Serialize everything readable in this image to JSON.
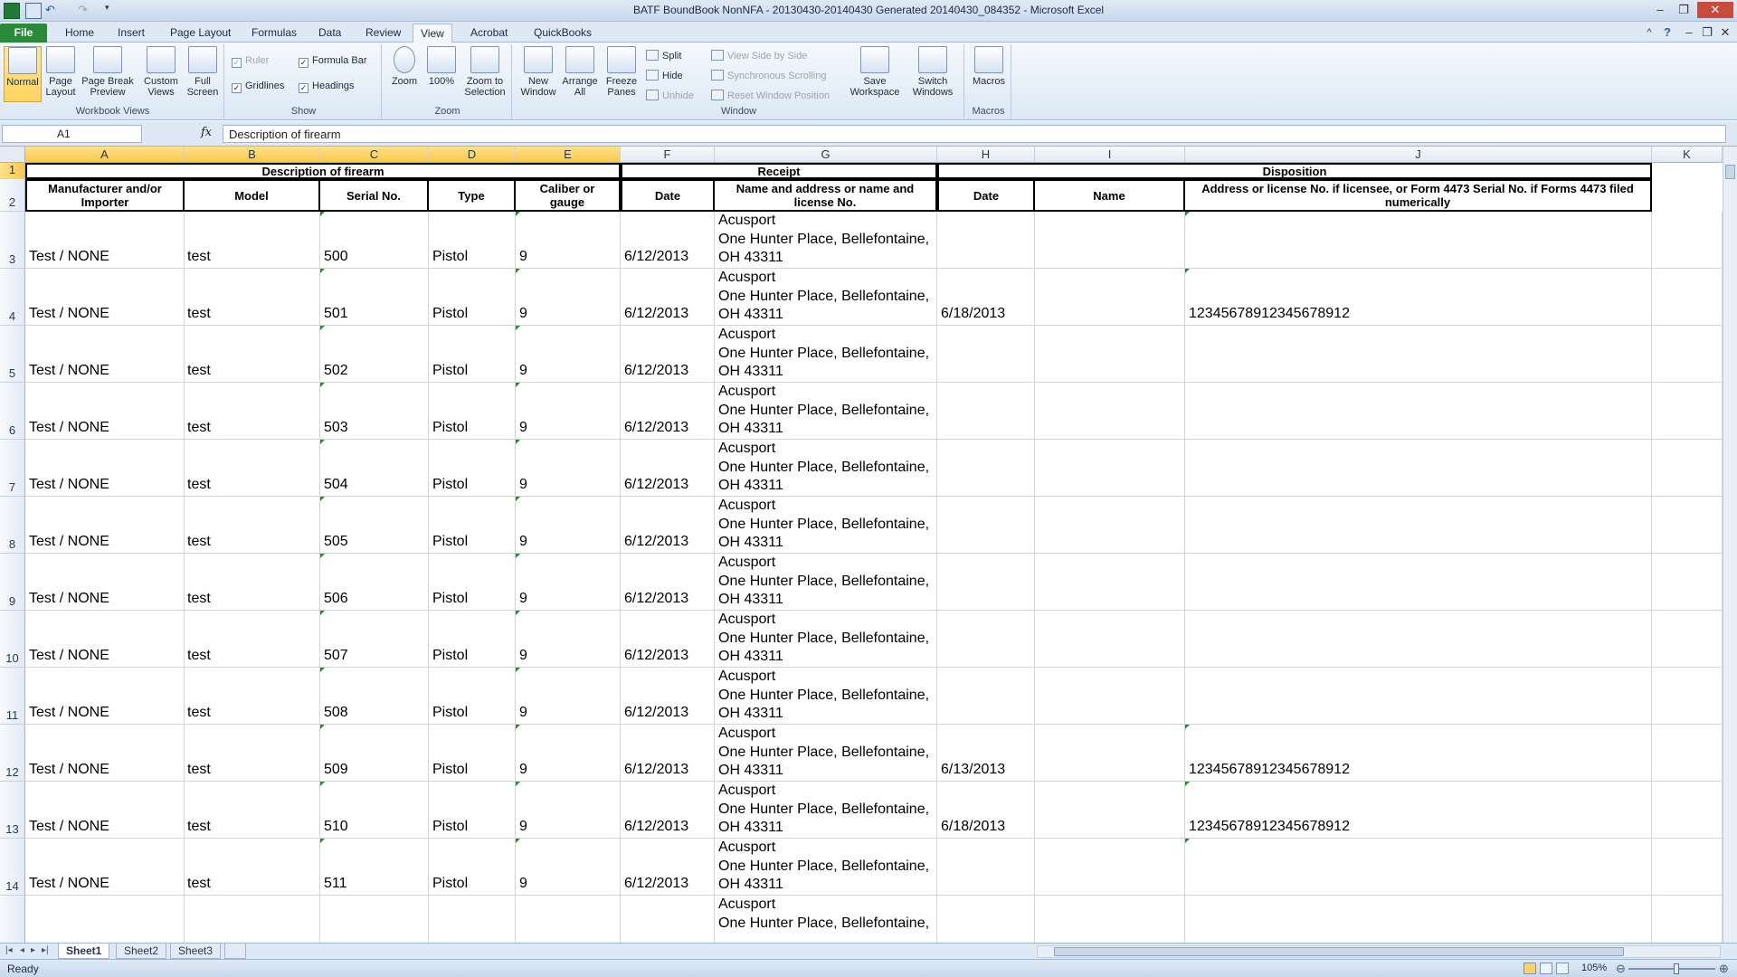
{
  "window": {
    "title": "BATF BoundBook NonNFA - 20130430-20140430 Generated 20140430_084352  -  Microsoft Excel"
  },
  "ribbon_tabs": [
    "File",
    "Home",
    "Insert",
    "Page Layout",
    "Formulas",
    "Data",
    "Review",
    "View",
    "Acrobat",
    "QuickBooks"
  ],
  "ribbon": {
    "workbook_views": {
      "label": "Workbook Views",
      "normal": "Normal",
      "page_layout": "Page Layout",
      "page_break": "Page Break Preview",
      "custom_views": "Custom Views",
      "full_screen": "Full Screen"
    },
    "show": {
      "label": "Show",
      "ruler": "Ruler",
      "formula_bar": "Formula Bar",
      "gridlines": "Gridlines",
      "headings": "Headings"
    },
    "zoom": {
      "label": "Zoom",
      "zoom": "Zoom",
      "hundred": "100%",
      "zoom_selection": "Zoom to Selection"
    },
    "window": {
      "label": "Window",
      "new_window": "New Window",
      "arrange_all": "Arrange All",
      "freeze_panes": "Freeze Panes",
      "split": "Split",
      "hide": "Hide",
      "unhide": "Unhide",
      "side_by_side": "View Side by Side",
      "sync_scroll": "Synchronous Scrolling",
      "reset_pos": "Reset Window Position",
      "save_workspace": "Save Workspace",
      "switch_windows": "Switch Windows"
    },
    "macros": {
      "label": "Macros",
      "macros": "Macros"
    }
  },
  "formula_bar": {
    "name_box": "A1",
    "fx": "fx",
    "formula": "Description of firearm"
  },
  "columns": [
    "A",
    "B",
    "C",
    "D",
    "E",
    "F",
    "G",
    "H",
    "I",
    "J",
    "K"
  ],
  "headers": {
    "group_description": "Description of firearm",
    "group_receipt": "Receipt",
    "group_disposition": "Disposition",
    "manufacturer": "Manufacturer and/or Importer",
    "model": "Model",
    "serial": "Serial No.",
    "type": "Type",
    "caliber": "Caliber or gauge",
    "receipt_date": "Date",
    "receipt_name": "Name and address or name and license No.",
    "disp_date": "Date",
    "disp_name": "Name",
    "disp_address": "Address or license No. if licensee, or Form 4473 Serial No. if Forms 4473 filed numerically"
  },
  "rows": [
    {
      "num": "3",
      "mfr": "Test / NONE",
      "model": "test",
      "serial": "500",
      "type": "Pistol",
      "caliber": "9",
      "date": "6/12/2013",
      "addr1": "Acusport",
      "addr2": "One Hunter Place, Bellefontaine,",
      "addr3": "OH 43311",
      "disp_date": "",
      "disp_addr": ""
    },
    {
      "num": "4",
      "mfr": "Test / NONE",
      "model": "test",
      "serial": "501",
      "type": "Pistol",
      "caliber": "9",
      "date": "6/12/2013",
      "addr1": "Acusport",
      "addr2": "One Hunter Place, Bellefontaine,",
      "addr3": "OH 43311",
      "disp_date": "6/18/2013",
      "disp_addr": "12345678912345678912"
    },
    {
      "num": "5",
      "mfr": "Test / NONE",
      "model": "test",
      "serial": "502",
      "type": "Pistol",
      "caliber": "9",
      "date": "6/12/2013",
      "addr1": "Acusport",
      "addr2": "One Hunter Place, Bellefontaine,",
      "addr3": "OH 43311",
      "disp_date": "",
      "disp_addr": ""
    },
    {
      "num": "6",
      "mfr": "Test / NONE",
      "model": "test",
      "serial": "503",
      "type": "Pistol",
      "caliber": "9",
      "date": "6/12/2013",
      "addr1": "Acusport",
      "addr2": "One Hunter Place, Bellefontaine,",
      "addr3": "OH 43311",
      "disp_date": "",
      "disp_addr": ""
    },
    {
      "num": "7",
      "mfr": "Test / NONE",
      "model": "test",
      "serial": "504",
      "type": "Pistol",
      "caliber": "9",
      "date": "6/12/2013",
      "addr1": "Acusport",
      "addr2": "One Hunter Place, Bellefontaine,",
      "addr3": "OH 43311",
      "disp_date": "",
      "disp_addr": ""
    },
    {
      "num": "8",
      "mfr": "Test / NONE",
      "model": "test",
      "serial": "505",
      "type": "Pistol",
      "caliber": "9",
      "date": "6/12/2013",
      "addr1": "Acusport",
      "addr2": "One Hunter Place, Bellefontaine,",
      "addr3": "OH 43311",
      "disp_date": "",
      "disp_addr": ""
    },
    {
      "num": "9",
      "mfr": "Test / NONE",
      "model": "test",
      "serial": "506",
      "type": "Pistol",
      "caliber": "9",
      "date": "6/12/2013",
      "addr1": "Acusport",
      "addr2": "One Hunter Place, Bellefontaine,",
      "addr3": "OH 43311",
      "disp_date": "",
      "disp_addr": ""
    },
    {
      "num": "10",
      "mfr": "Test / NONE",
      "model": "test",
      "serial": "507",
      "type": "Pistol",
      "caliber": "9",
      "date": "6/12/2013",
      "addr1": "Acusport",
      "addr2": "One Hunter Place, Bellefontaine,",
      "addr3": "OH 43311",
      "disp_date": "",
      "disp_addr": ""
    },
    {
      "num": "11",
      "mfr": "Test / NONE",
      "model": "test",
      "serial": "508",
      "type": "Pistol",
      "caliber": "9",
      "date": "6/12/2013",
      "addr1": "Acusport",
      "addr2": "One Hunter Place, Bellefontaine,",
      "addr3": "OH 43311",
      "disp_date": "",
      "disp_addr": ""
    },
    {
      "num": "12",
      "mfr": "Test / NONE",
      "model": "test",
      "serial": "509",
      "type": "Pistol",
      "caliber": "9",
      "date": "6/12/2013",
      "addr1": "Acusport",
      "addr2": "One Hunter Place, Bellefontaine,",
      "addr3": "OH 43311",
      "disp_date": "6/13/2013",
      "disp_addr": "12345678912345678912"
    },
    {
      "num": "13",
      "mfr": "Test / NONE",
      "model": "test",
      "serial": "510",
      "type": "Pistol",
      "caliber": "9",
      "date": "6/12/2013",
      "addr1": "Acusport",
      "addr2": "One Hunter Place, Bellefontaine,",
      "addr3": "OH 43311",
      "disp_date": "6/18/2013",
      "disp_addr": "12345678912345678912"
    },
    {
      "num": "14",
      "mfr": "Test / NONE",
      "model": "test",
      "serial": "511",
      "type": "Pistol",
      "caliber": "9",
      "date": "6/12/2013",
      "addr1": "Acusport",
      "addr2": "One Hunter Place, Bellefontaine,",
      "addr3": "OH 43311",
      "disp_date": "",
      "disp_addr": ""
    },
    {
      "num": "",
      "mfr": "",
      "model": "",
      "serial": "",
      "type": "",
      "caliber": "",
      "date": "",
      "addr1": "Acusport",
      "addr2": "One Hunter Place, Bellefontaine,",
      "addr3": "",
      "disp_date": "",
      "disp_addr": ""
    }
  ],
  "sheets": [
    "Sheet1",
    "Sheet2",
    "Sheet3"
  ],
  "status": {
    "ready": "Ready",
    "zoom": "105%"
  }
}
